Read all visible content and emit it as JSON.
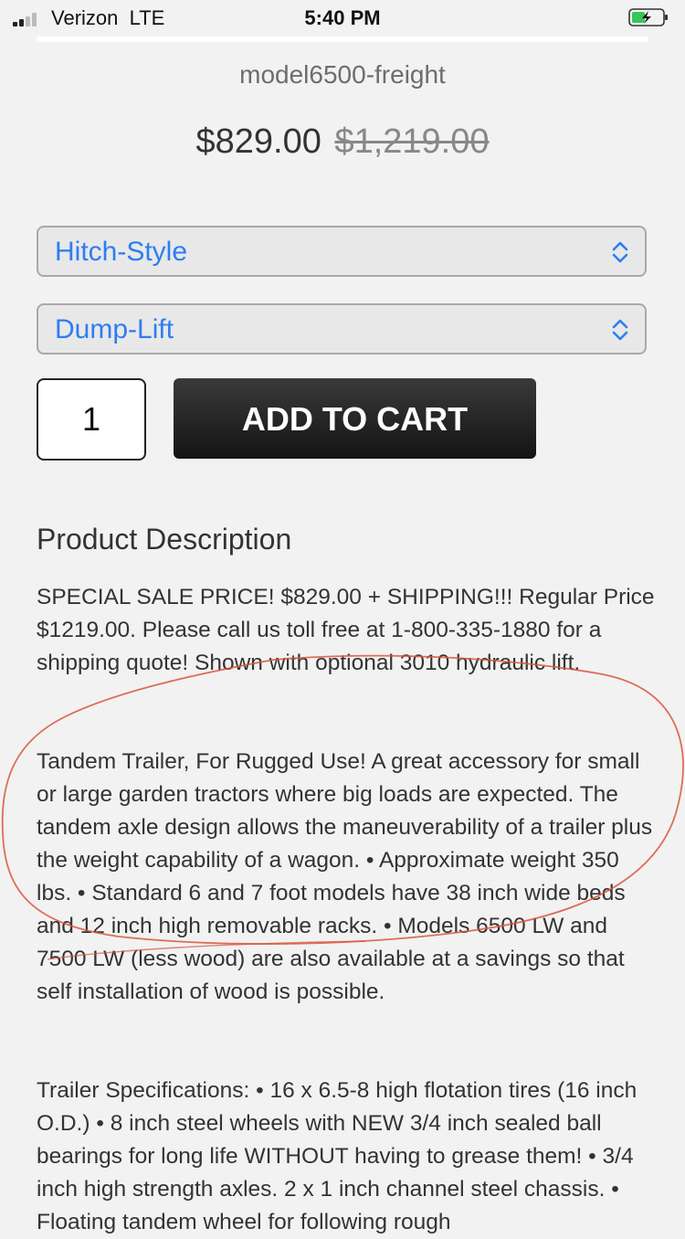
{
  "status_bar": {
    "carrier": "Verizon  LTE",
    "time": "5:40 PM",
    "signal_icon": "signal-bars-icon",
    "battery_icon": "battery-charging-icon"
  },
  "product": {
    "slug": "model6500-freight",
    "price": "$829.00",
    "price_old": "$1,219.00"
  },
  "options": {
    "hitch": {
      "label": "Hitch-Style",
      "icon": "chevron-updown-icon"
    },
    "dump": {
      "label": "Dump-Lift",
      "icon": "chevron-updown-icon"
    }
  },
  "cart": {
    "quantity": "1",
    "add_label": "ADD TO CART"
  },
  "description": {
    "heading": "Product Description",
    "paragraphs": [
      "SPECIAL SALE PRICE! $829.00 + SHIPPING!!! Regular Price $1219.00. Please call us toll free at 1-800-335-1880 for a shipping quote! Shown with optional 3010 hydraulic lift.",
      "Tandem Trailer, For Rugged Use! A great accessory for small or large garden tractors where big loads are expected. The tandem axle design allows the maneuverability of a trailer plus the weight capability of a wagon. • Approximate weight 350 lbs. • Standard 6 and 7 foot models have 38 inch wide beds and 12 inch high removable racks. • Models 6500 LW and 7500 LW (less wood) are also available at a savings so that self installation of wood is possible.",
      "Trailer Specifications: • 16 x 6.5-8 high flotation tires (16 inch O.D.) • 8 inch steel wheels with NEW 3/4 inch sealed ball bearings for long life WITHOUT having to grease them! • 3/4 inch high strength axles. 2 x 1 inch channel steel chassis. • Floating tandem wheel for following rough"
    ]
  },
  "colors": {
    "link_blue": "#2e7df2",
    "button_dark": "#1c1c1c",
    "annotation_red": "#d9563d"
  }
}
